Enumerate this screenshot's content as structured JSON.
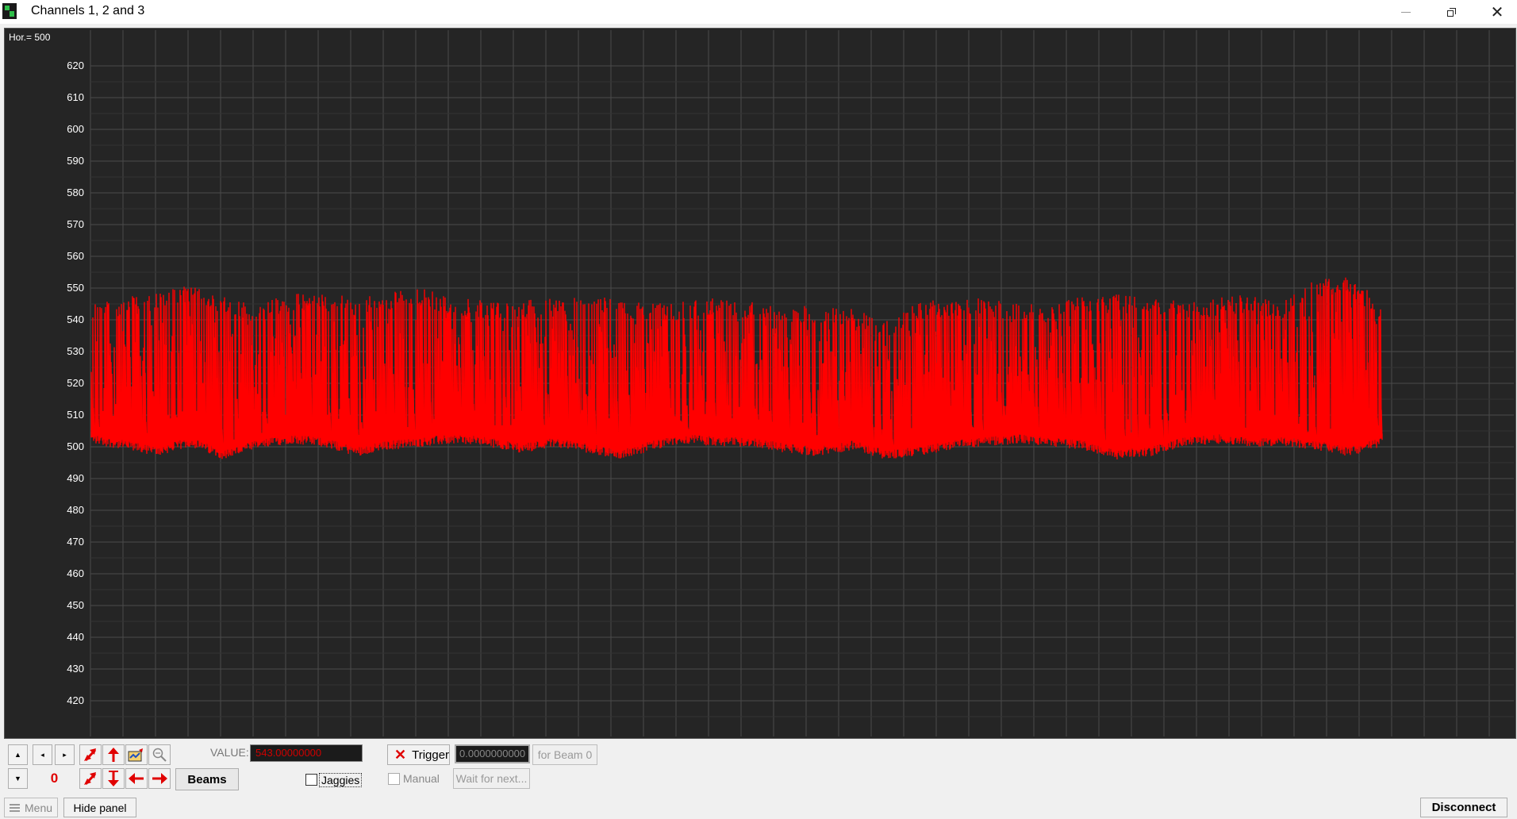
{
  "window": {
    "title": "Channels 1, 2 and 3"
  },
  "scope": {
    "hor_label": "Hor.= 500",
    "background": "#252525",
    "grid_color": "#4a4a4a",
    "trace_color": "#ff0000"
  },
  "chart_data": {
    "type": "line",
    "title": "",
    "xlabel": "",
    "ylabel": "",
    "ylim": [
      411,
      632
    ],
    "y_ticks": [
      620,
      610,
      600,
      590,
      580,
      570,
      560,
      550,
      540,
      530,
      520,
      510,
      500,
      490,
      480,
      470,
      460,
      450,
      440,
      430,
      420
    ],
    "grid": true,
    "series": [
      {
        "baseline": 501,
        "typical_peak": 547,
        "min": 494,
        "max": 554,
        "envelope_low": [
          501,
          499,
          497,
          500,
          496,
          499,
          501,
          500,
          497,
          499,
          500,
          501,
          500,
          498,
          500,
          498,
          496,
          499,
          501,
          500,
          500,
          498,
          497,
          499,
          496,
          497,
          499,
          500,
          501,
          500,
          499,
          496,
          497,
          500,
          501,
          500,
          500,
          499,
          497,
          500
        ],
        "envelope_high": [
          546,
          547,
          549,
          551,
          548,
          545,
          548,
          549,
          547,
          549,
          550,
          547,
          546,
          546,
          547,
          548,
          547,
          545,
          546,
          548,
          546,
          545,
          545,
          544,
          540,
          546,
          547,
          547,
          546,
          545,
          548,
          548,
          547,
          546,
          547,
          548,
          546,
          553,
          554,
          546
        ]
      }
    ]
  },
  "controls": {
    "scroll_up": "▲",
    "scroll_down": "▼",
    "scroll_left": "◂",
    "scroll_right": "▸",
    "beam_number": "0",
    "beams_label": "Beams",
    "value_label": "VALUE:",
    "value": "543.00000000",
    "jaggies_label": "Jaggies",
    "jaggies_checked": false,
    "trigger_label": "Trigger",
    "trigger_value": "0.0000000000",
    "for_beam_label": "for Beam 0",
    "manual_label": "Manual",
    "manual_checked": false,
    "wait_label": "Wait for next..."
  },
  "bottom": {
    "menu_label": "Menu",
    "hide_panel_label": "Hide panel",
    "disconnect_label": "Disconnect"
  }
}
